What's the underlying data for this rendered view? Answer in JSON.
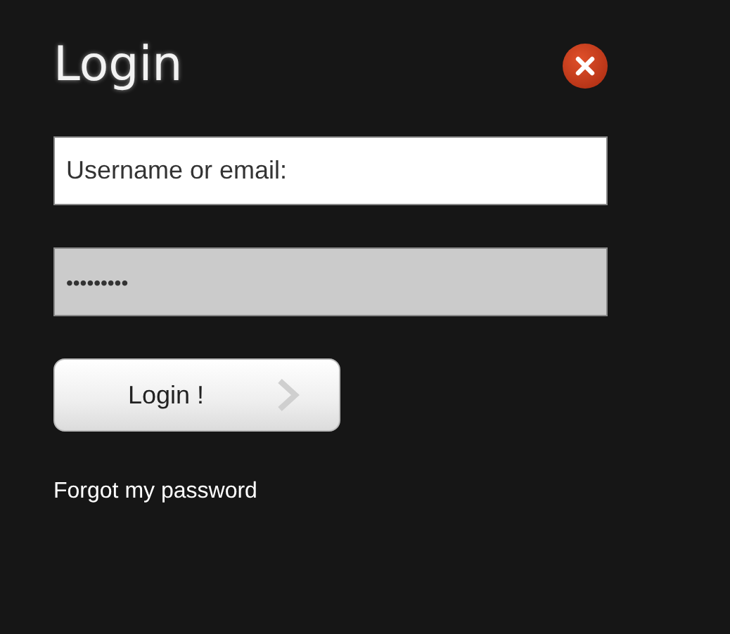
{
  "title": "Login",
  "fields": [
    {
      "kind": "text",
      "value": "Username or email:",
      "focused": false
    },
    {
      "kind": "password",
      "value": "•••••••••",
      "focused": true
    }
  ],
  "submit": {
    "label": "Login !"
  },
  "link": "Forgot my password"
}
